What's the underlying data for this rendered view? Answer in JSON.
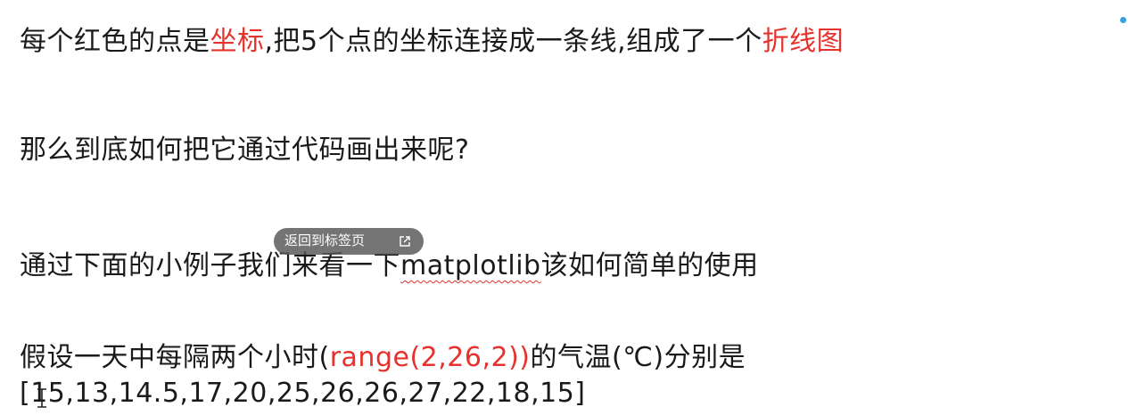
{
  "lines": {
    "l1": {
      "p1": "每个红色的点是",
      "p2": "坐标",
      "p3": ",把5个点的坐标连接成一条线,组成了一个",
      "p4": "折线图"
    },
    "l2": "那么到底如何把它通过代码画出来呢?",
    "l3": {
      "p1": "通过下面的小例子我们来看一下",
      "p2": "matplotlib",
      "p3": "该如何简单的使用"
    },
    "l4": {
      "p1": "假设一天中每隔两个小时(",
      "p2": "range(2,26,2))",
      "p3": "的气温(℃)分别是"
    },
    "l5": "[15,13,14.5,17,20,25,26,26,27,22,18,15]"
  },
  "overlay": {
    "back_to_tab_label": "返回到标签页",
    "icon": "external-link-icon"
  },
  "colors": {
    "highlight": "#e5322d",
    "text": "#1a1a1a",
    "pill_bg": "#555555",
    "indicator_dot": "#3aa0e0"
  }
}
